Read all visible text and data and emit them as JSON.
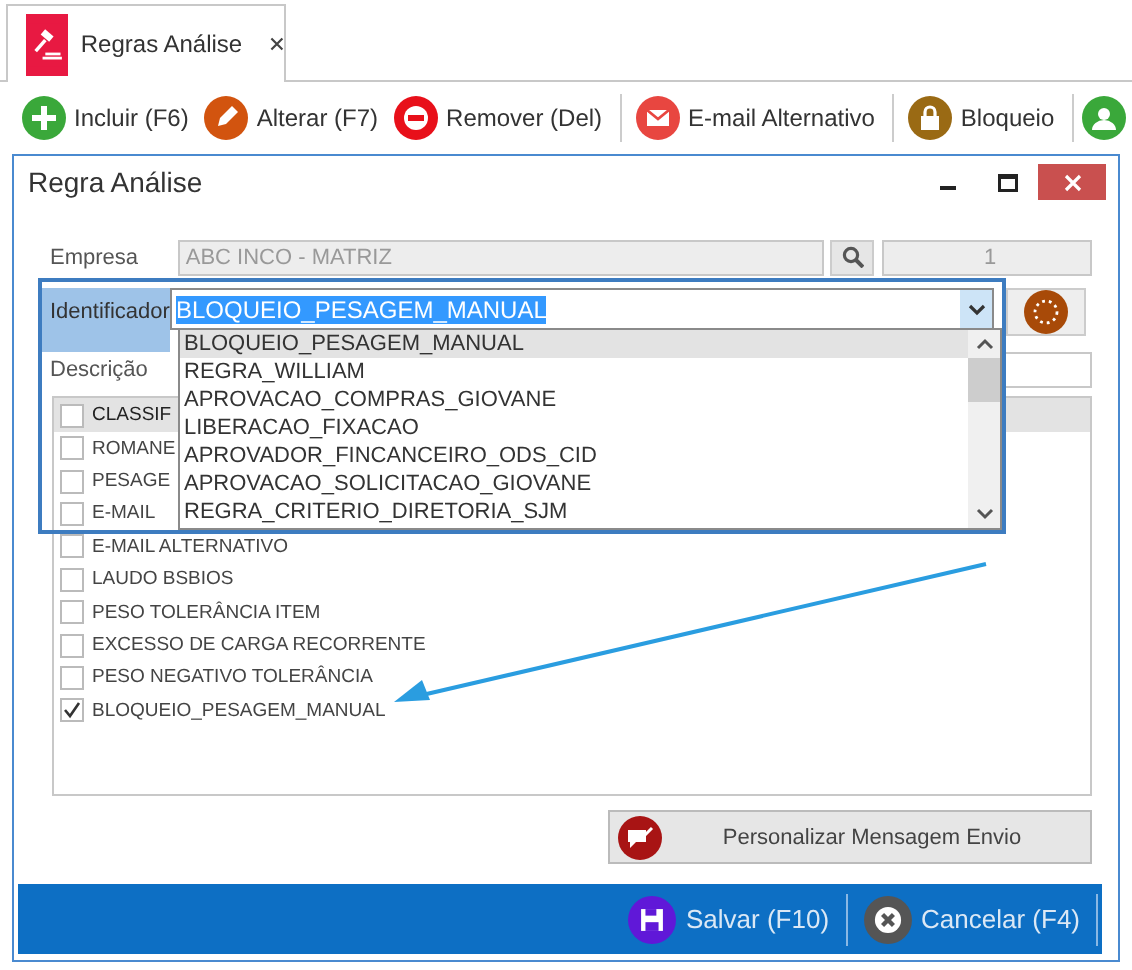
{
  "tab": {
    "label": "Regras Análise",
    "selected": true
  },
  "toolbar": [
    {
      "label": "Incluir (F6)",
      "kind": "add"
    },
    {
      "label": "Alterar (F7)",
      "kind": "edit"
    },
    {
      "label": "Remover (Del)",
      "kind": "remove"
    },
    {
      "label": "E-mail Alternativo",
      "kind": "mail"
    },
    {
      "label": "Bloqueio",
      "kind": "lock"
    },
    {
      "kind": "user"
    }
  ],
  "dialog": {
    "title": "Regra Análise",
    "empresa": {
      "label": "Empresa",
      "value": "ABC INCO - MATRIZ",
      "code": "1",
      "disabled": true
    },
    "identificador": {
      "label": "Identificador",
      "value": "BLOQUEIO_PESAGEM_MANUAL",
      "value_highlighted": true,
      "expanded": true,
      "options": [
        {
          "label": "BLOQUEIO_PESAGEM_MANUAL",
          "selected": true
        },
        {
          "label": "REGRA_WILLIAM",
          "selected": false
        },
        {
          "label": "APROVACAO_COMPRAS_GIOVANE",
          "selected": false
        },
        {
          "label": "LIBERACAO_FIXACAO",
          "selected": false
        },
        {
          "label": "APROVADOR_FINCANCEIRO_ODS_CID",
          "selected": false
        },
        {
          "label": "APROVACAO_SOLICITACAO_GIOVANE",
          "selected": false
        },
        {
          "label": "REGRA_CRITERIO_DIRETORIA_SJM",
          "selected": false
        }
      ]
    },
    "descricao": {
      "label": "Descrição"
    },
    "checklist": {
      "header": {
        "label": "CLASSIF",
        "checked": false
      },
      "items": [
        {
          "label": "ROMANE",
          "checked": false
        },
        {
          "label": "PESAGE",
          "checked": false
        },
        {
          "label": "E-MAIL",
          "checked": false
        },
        {
          "label": "E-MAIL ALTERNATIVO",
          "checked": false
        },
        {
          "label": "LAUDO BSBIOS",
          "checked": false
        },
        {
          "label": "PESO TOLERÂNCIA ITEM",
          "checked": false
        },
        {
          "label": "EXCESSO DE CARGA RECORRENTE",
          "checked": false
        },
        {
          "label": "PESO NEGATIVO TOLERÂNCIA",
          "checked": false
        },
        {
          "label": "BLOQUEIO_PESAGEM_MANUAL",
          "checked": true
        }
      ]
    },
    "message_button": "Personalizar Mensagem Envio",
    "footer": [
      {
        "label": "Salvar (F10)",
        "kind": "save"
      },
      {
        "label": "Cancelar (F4)",
        "kind": "cancel"
      }
    ]
  }
}
